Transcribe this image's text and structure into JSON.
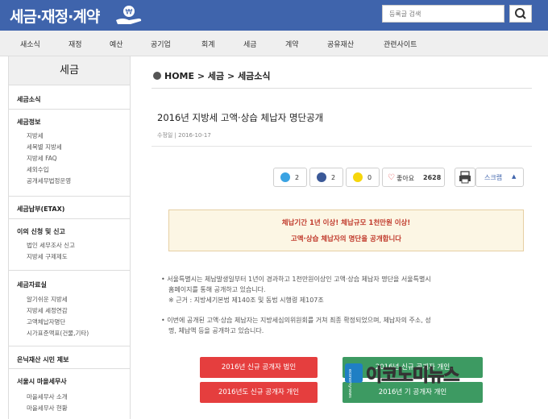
{
  "header": {
    "logo_text": "세금·재정·계약",
    "search_placeholder": "등록글 검색"
  },
  "nav": {
    "items": [
      "새소식",
      "재정",
      "예산",
      "공기업",
      "회계",
      "세금",
      "계약",
      "공유재산",
      "관련사이트"
    ]
  },
  "sidebar": {
    "title": "세금",
    "sections": [
      {
        "head": "세금소식",
        "items": []
      },
      {
        "head": "세금정보",
        "items": [
          "지방세",
          "세목별 지방세",
          "지방세 FAQ",
          "세외수입",
          "공개세무법정운영"
        ]
      },
      {
        "head": "세금납부(ETAX)",
        "items": []
      },
      {
        "head": "이의 신청 및 신고",
        "items": [
          "법인 세무조사 신고",
          "지방세 구제제도"
        ]
      },
      {
        "head": "세금자료실",
        "items": [
          "알기쉬운 지방세",
          "지방세 세정연감",
          "고액체납자명단",
          "시가표준액표(건물,기타)"
        ]
      },
      {
        "head": "은닉재산 시민 제보",
        "items": []
      },
      {
        "head": "서울시 마을세무사",
        "items": [
          "마을세무사 소개",
          "마을세무사 현황"
        ]
      }
    ]
  },
  "breadcrumb": {
    "home": "HOME",
    "level1": "세금",
    "level2": "세금소식"
  },
  "post": {
    "title": "2016년 지방세 고액·상습 체납자 명단공개",
    "meta": "수정일 | 2016-10-17"
  },
  "share": {
    "twitter_count": "2",
    "facebook_count": "2",
    "kakao_count": "0",
    "like_label": "좋아요",
    "like_count": "2628",
    "scrap_label": "스크랩"
  },
  "notice": {
    "line1": "체납기간 1년 이상! 체납규모 1천만원 이상!",
    "line2": "고액·상습 체납자의 명단을 공개합니다"
  },
  "body": {
    "bullet1_line1": "서울특별시는 체납발생일부터 1년이 경과하고 1천만원이상인 고액·상습 체납자 명단을 서울특별시",
    "bullet1_line2": "홈페이지를 통해 공개하고 있습니다.",
    "bullet1_note": "※ 근거 : 지방세기본법 제140조 및 동법 시행령 제107조",
    "bullet2_line1": "이번에 공개된 고액·상습 체납자는 지방세심의위원회를 거쳐 최종 확정되었으며, 체납자의 주소, 성",
    "bullet2_line2": "명, 체납액 등을 공개하고 있습니다."
  },
  "buttons": {
    "btn1": "2016년 신규 공개자 법인",
    "btn2": "2016년 신규 공개자 개인",
    "btn3": "2016년도 신규 공개자 개인",
    "btn4": "2016년 기 공개자 개인"
  },
  "watermark": {
    "text": "이코노미뉴스",
    "sub": "economynews"
  },
  "colors": {
    "header_bg": "#3f64ac",
    "red_button": "#e53e3e",
    "green_button": "#3d9a62",
    "notice_text": "#c0392b"
  }
}
